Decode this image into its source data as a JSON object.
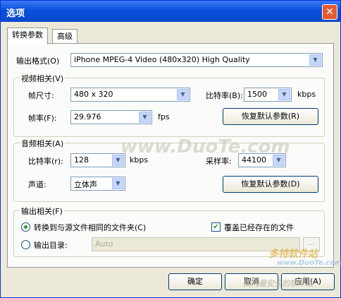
{
  "window": {
    "title": "选项"
  },
  "tabs": [
    {
      "label": "转换参数"
    },
    {
      "label": "高级"
    }
  ],
  "output_format": {
    "label": "输出格式(O)",
    "value": "iPhone MPEG-4 Video (480x320) High Quality"
  },
  "video": {
    "group_title": "视频相关(V)",
    "frame_size": {
      "label": "帧尺寸:",
      "value": "480 x 320"
    },
    "bitrate": {
      "label": "比特率(B):",
      "value": "1500",
      "unit": "kbps"
    },
    "framerate": {
      "label": "帧率(F):",
      "value": "29.976",
      "unit": "fps"
    },
    "restore_button": "恢复默认参数(R)"
  },
  "audio": {
    "group_title": "音频相关(A)",
    "bitrate": {
      "label": "比特率(r):",
      "value": "128",
      "unit": "kbps"
    },
    "samplerate": {
      "label": "采样率:",
      "value": "44100"
    },
    "channel": {
      "label": "声道:",
      "value": "立体声"
    },
    "restore_button": "恢复默认参数(D)"
  },
  "output": {
    "group_title": "输出相关(F)",
    "same_folder_label": "转换到与源文件相同的文件夹(C)",
    "overwrite_label": "覆盖已经存在的文件",
    "dir_label": "输出目录:",
    "dir_value": "Auto",
    "browse_label": "..."
  },
  "buttons": {
    "ok": "确定",
    "cancel": "取消",
    "apply": "应用(A)"
  },
  "watermarks": {
    "center": "www.DuoTe.com",
    "corner_brand": "多特软件站",
    "corner_url": "www.DuoTe.com",
    "footer": "国内最安全的软件站"
  }
}
